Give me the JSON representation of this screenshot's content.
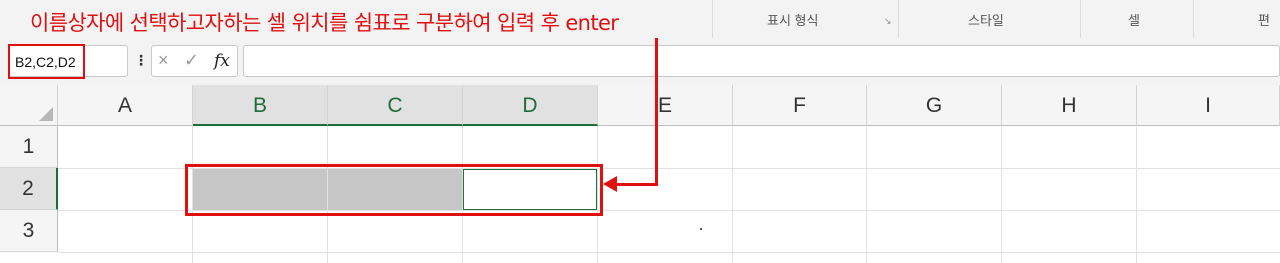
{
  "annotation": {
    "instruction": "이름상자에 선택하고자하는 셀 위치를 쉼표로 구분하여 입력 후 enter",
    "color": "#e01010"
  },
  "ribbon": {
    "groups": [
      "표시 형식",
      "스타일",
      "셀",
      "편"
    ]
  },
  "formula_bar": {
    "name_box_value": "B2,C2,D2",
    "more_dots": "⋮",
    "cancel_icon": "×",
    "enter_icon": "✓",
    "fx_label": "fx",
    "formula_value": ""
  },
  "sheet": {
    "columns": [
      "A",
      "B",
      "C",
      "D",
      "E",
      "F",
      "G",
      "H",
      "I"
    ],
    "rows": [
      "1",
      "2",
      "3"
    ],
    "selected_cells": [
      "B2",
      "C2",
      "D2"
    ],
    "active_cell": "D2",
    "accent": "#1f6b3a"
  }
}
